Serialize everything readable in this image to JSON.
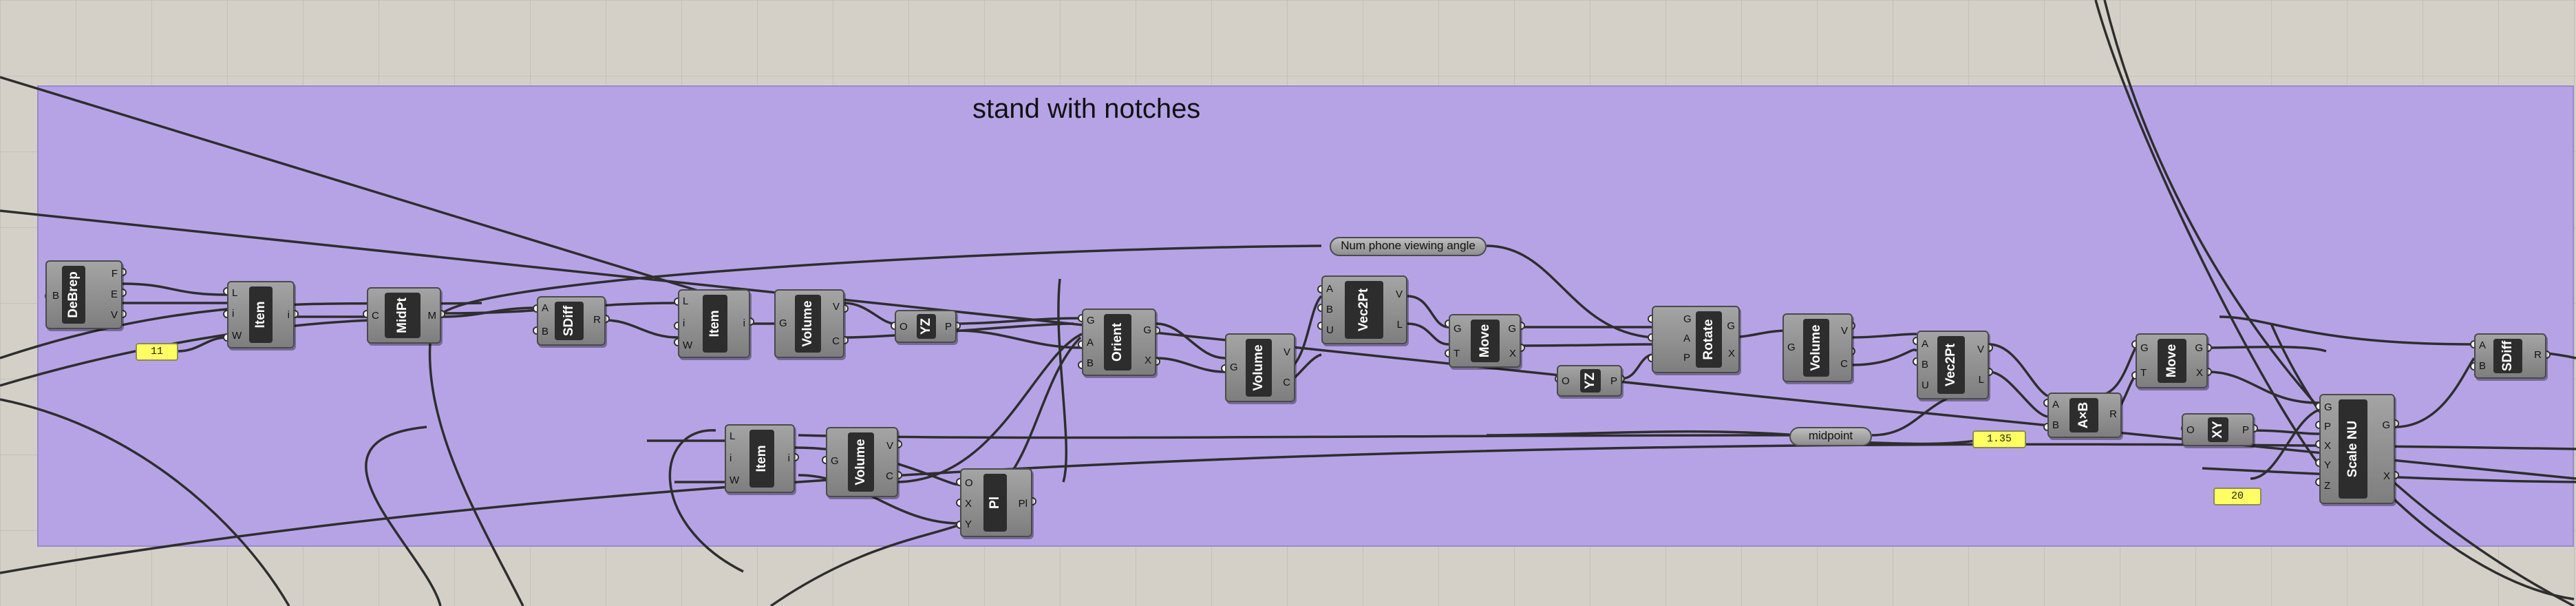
{
  "group": {
    "title": "stand with notches"
  },
  "components": {
    "debrep": {
      "name": "DeBrep",
      "inputs": [
        "B"
      ],
      "outputs": [
        "F",
        "E",
        "V"
      ]
    },
    "item1": {
      "name": "Item",
      "inputs": [
        "L",
        "i",
        "W"
      ],
      "outputs": [
        "i"
      ]
    },
    "midpt": {
      "name": "MidPt",
      "inputs": [
        "C"
      ],
      "outputs": [
        "M"
      ]
    },
    "sdiff1": {
      "name": "SDiff",
      "inputs": [
        "A",
        "B"
      ],
      "outputs": [
        "R"
      ]
    },
    "item2": {
      "name": "Item",
      "inputs": [
        "L",
        "i",
        "W"
      ],
      "outputs": [
        "i"
      ]
    },
    "volume1": {
      "name": "Volume",
      "inputs": [
        "G"
      ],
      "outputs": [
        "V",
        "C"
      ]
    },
    "yz1": {
      "name": "YZ",
      "inputs": [
        "O"
      ],
      "outputs": [
        "P"
      ]
    },
    "item3": {
      "name": "Item",
      "inputs": [
        "L",
        "i",
        "W"
      ],
      "outputs": [
        "i"
      ]
    },
    "volume2": {
      "name": "Volume",
      "inputs": [
        "G"
      ],
      "outputs": [
        "V",
        "C"
      ]
    },
    "pl": {
      "name": "Pl",
      "inputs": [
        "O",
        "X",
        "Y"
      ],
      "outputs": [
        "Pl"
      ]
    },
    "orient": {
      "name": "Orient",
      "inputs": [
        "G",
        "A",
        "B"
      ],
      "outputs": [
        "G",
        "X"
      ]
    },
    "volume3": {
      "name": "Volume",
      "inputs": [
        "G"
      ],
      "outputs": [
        "V",
        "C"
      ]
    },
    "vec2pt1": {
      "name": "Vec2Pt",
      "inputs": [
        "A",
        "B",
        "U"
      ],
      "outputs": [
        "V",
        "L"
      ]
    },
    "move1": {
      "name": "Move",
      "inputs": [
        "G",
        "T"
      ],
      "outputs": [
        "G",
        "X"
      ]
    },
    "yz2": {
      "name": "YZ",
      "inputs": [
        "O"
      ],
      "outputs": [
        "P"
      ]
    },
    "rotate": {
      "name": "Rotate",
      "inputs": [
        "G",
        "A",
        "P"
      ],
      "outputs": [
        "G",
        "X"
      ]
    },
    "volume4": {
      "name": "Volume",
      "inputs": [
        "G"
      ],
      "outputs": [
        "V",
        "C"
      ]
    },
    "vec2pt2": {
      "name": "Vec2Pt",
      "inputs": [
        "A",
        "B",
        "U"
      ],
      "outputs": [
        "V",
        "L"
      ]
    },
    "axb": {
      "name": "A×B",
      "inputs": [
        "A",
        "B"
      ],
      "outputs": [
        "R"
      ]
    },
    "move2": {
      "name": "Move",
      "inputs": [
        "G",
        "T"
      ],
      "outputs": [
        "G",
        "X"
      ]
    },
    "xy": {
      "name": "XY",
      "inputs": [
        "O"
      ],
      "outputs": [
        "P"
      ]
    },
    "scalenu": {
      "name": "Scale NU",
      "inputs": [
        "G",
        "P",
        "X",
        "Y",
        "Z"
      ],
      "outputs": [
        "G",
        "X"
      ]
    },
    "sdiff2": {
      "name": "SDiff",
      "inputs": [
        "A",
        "B"
      ],
      "outputs": [
        "R"
      ]
    }
  },
  "panels": {
    "p11": "11",
    "p135": "1.35",
    "p20": "20"
  },
  "relays": {
    "phone": "Num phone viewing angle",
    "midpoint": "midpoint"
  }
}
